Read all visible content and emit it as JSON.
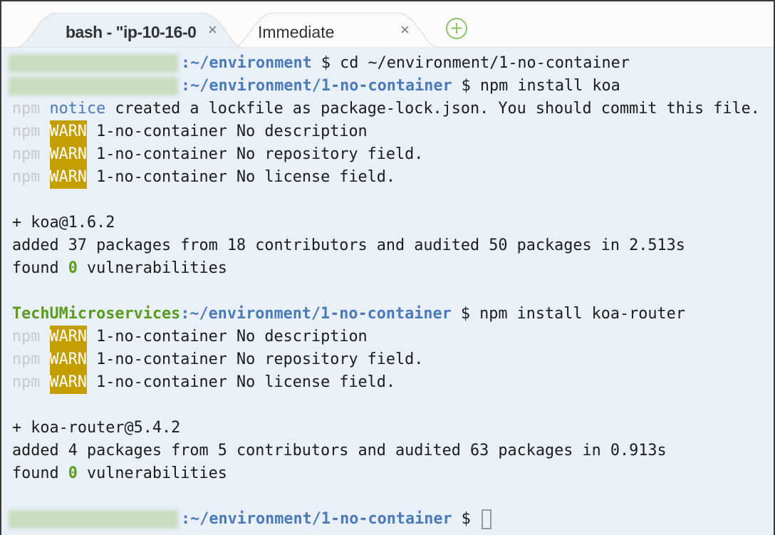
{
  "tabs": [
    {
      "label": "bash - \"ip-10-16-0",
      "close": "×",
      "active": true
    },
    {
      "label": "Immediate",
      "close": "×",
      "active": false
    }
  ],
  "add_tab": "+",
  "colors": {
    "background": "#e9f0f8",
    "host": "#5a9a1e",
    "path": "#4a7ab8",
    "warn_bg": "#c49e00"
  },
  "lines": [
    [
      {
        "t": "blur"
      },
      {
        "t": "path",
        "v": ":~/environment"
      },
      {
        "t": "plain",
        "v": " $ cd ~/environment/1-no-container"
      }
    ],
    [
      {
        "t": "blur"
      },
      {
        "t": "path",
        "v": ":~/environment/1-no-container"
      },
      {
        "t": "plain",
        "v": " $ npm install koa"
      }
    ],
    [
      {
        "t": "npm",
        "v": "npm"
      },
      {
        "t": "plain",
        "v": " "
      },
      {
        "t": "notice",
        "v": "notice"
      },
      {
        "t": "plain",
        "v": " created a lockfile as package-lock.json. You should commit this file."
      }
    ],
    [
      {
        "t": "npm",
        "v": "npm"
      },
      {
        "t": "plain",
        "v": " "
      },
      {
        "t": "warn",
        "v": "WARN"
      },
      {
        "t": "plain",
        "v": " 1-no-container No description"
      }
    ],
    [
      {
        "t": "npm",
        "v": "npm"
      },
      {
        "t": "plain",
        "v": " "
      },
      {
        "t": "warn",
        "v": "WARN"
      },
      {
        "t": "plain",
        "v": " 1-no-container No repository field."
      }
    ],
    [
      {
        "t": "npm",
        "v": "npm"
      },
      {
        "t": "plain",
        "v": " "
      },
      {
        "t": "warn",
        "v": "WARN"
      },
      {
        "t": "plain",
        "v": " 1-no-container No license field."
      }
    ],
    [],
    [
      {
        "t": "plain",
        "v": "+ koa@1.6.2"
      }
    ],
    [
      {
        "t": "plain",
        "v": "added 37 packages from 18 contributors and audited 50 packages in 2.513s"
      }
    ],
    [
      {
        "t": "plain",
        "v": "found "
      },
      {
        "t": "zero",
        "v": "0"
      },
      {
        "t": "plain",
        "v": " vulnerabilities"
      }
    ],
    [],
    [
      {
        "t": "host",
        "v": "TechUMicroservices"
      },
      {
        "t": "path",
        "v": ":~/environment/1-no-container"
      },
      {
        "t": "plain",
        "v": " $ npm install koa-router"
      }
    ],
    [
      {
        "t": "npm",
        "v": "npm"
      },
      {
        "t": "plain",
        "v": " "
      },
      {
        "t": "warn",
        "v": "WARN"
      },
      {
        "t": "plain",
        "v": " 1-no-container No description"
      }
    ],
    [
      {
        "t": "npm",
        "v": "npm"
      },
      {
        "t": "plain",
        "v": " "
      },
      {
        "t": "warn",
        "v": "WARN"
      },
      {
        "t": "plain",
        "v": " 1-no-container No repository field."
      }
    ],
    [
      {
        "t": "npm",
        "v": "npm"
      },
      {
        "t": "plain",
        "v": " "
      },
      {
        "t": "warn",
        "v": "WARN"
      },
      {
        "t": "plain",
        "v": " 1-no-container No license field."
      }
    ],
    [],
    [
      {
        "t": "plain",
        "v": "+ koa-router@5.4.2"
      }
    ],
    [
      {
        "t": "plain",
        "v": "added 4 packages from 5 contributors and audited 63 packages in 0.913s"
      }
    ],
    [
      {
        "t": "plain",
        "v": "found "
      },
      {
        "t": "zero",
        "v": "0"
      },
      {
        "t": "plain",
        "v": " vulnerabilities"
      }
    ],
    [],
    [
      {
        "t": "blur"
      },
      {
        "t": "path",
        "v": ":~/environment/1-no-container"
      },
      {
        "t": "plain",
        "v": " $ "
      },
      {
        "t": "cursor"
      }
    ]
  ]
}
